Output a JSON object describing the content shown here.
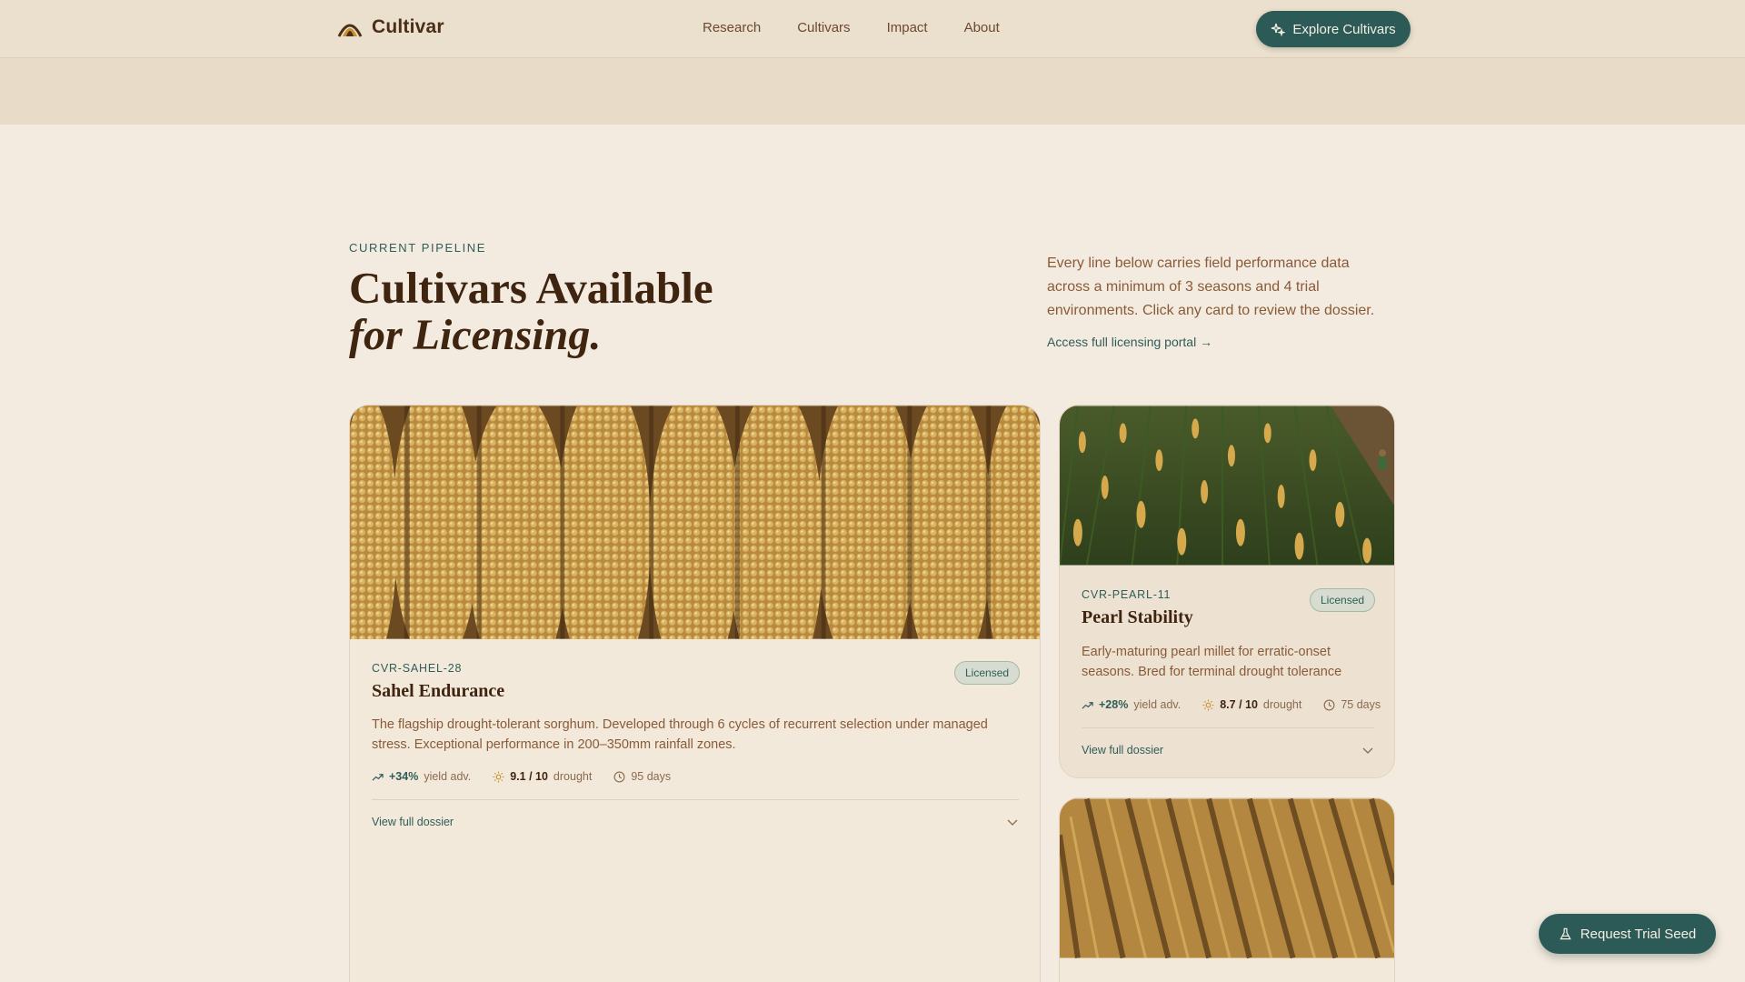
{
  "brand": {
    "name": "Cultivar"
  },
  "nav": {
    "items": [
      "Research",
      "Cultivars",
      "Impact",
      "About"
    ]
  },
  "header_cta": {
    "label": "Explore Cultivars",
    "icon": "sparkle-icon"
  },
  "hero": {
    "eyebrow": "CURRENT PIPELINE",
    "title_line1": "Cultivars Available",
    "title_line2": "for Licensing.",
    "intro": "Every line below carries field performance data across a minimum of 3 seasons and 4 trial environments. Click any card to review the dossier.",
    "portal_link": "Access full licensing portal →"
  },
  "cards": [
    {
      "code": "CVR-SAHEL-28",
      "name": "Sahel Endurance",
      "badge": "Licensed",
      "description": "The flagship drought-tolerant sorghum. Developed through 6 cycles of recurrent selection under managed stress. Exceptional performance in 200–350mm rainfall zones.",
      "yield": "+34%",
      "yield_label": "yield adv.",
      "drought": "9.1 / 10",
      "drought_label": "drought",
      "days": "95 days",
      "dossier": "View full dossier"
    },
    {
      "code": "CVR-PEARL-11",
      "name": "Pearl Stability",
      "badge": "Licensed",
      "description": "Early-maturing pearl millet for erratic-onset seasons. Bred for terminal drought tolerance with…",
      "yield": "+28%",
      "yield_label": "yield adv.",
      "drought": "8.7 / 10",
      "drought_label": "drought",
      "days": "75 days",
      "dossier": "View full dossier"
    }
  ],
  "fab": {
    "label": "Request Trial Seed",
    "icon": "flask-icon"
  },
  "colors": {
    "accent": "#2c5a57",
    "heading": "#3f2410",
    "background": "#f3ebdf"
  }
}
